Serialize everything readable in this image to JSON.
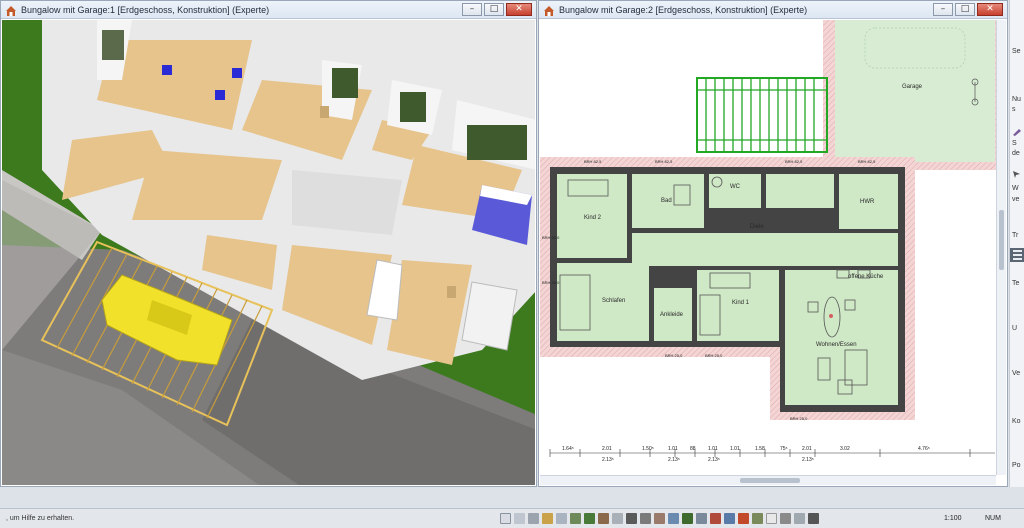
{
  "left_window": {
    "title": "Bungalow mit Garage:1 [Erdgeschoss, Konstruktion] (Experte)",
    "controls": {
      "minimize": "–",
      "maximize": "□",
      "close": "✕"
    }
  },
  "right_window": {
    "title": "Bungalow mit Garage:2 [Erdgeschoss, Konstruktion] (Experte)",
    "controls": {
      "minimize": "–",
      "maximize": "□",
      "close": "✕"
    },
    "rooms": {
      "garage": "Garage",
      "kind2": "Kind 2",
      "bad": "Bad",
      "wc": "WC",
      "hwr": "HWR",
      "diele": "Diele",
      "schlafen": "Schlafen",
      "ankleide": "Ankleide",
      "kind1": "Kind 1",
      "kueche": "offene Küche",
      "wohnen": "Wohnen/Essen"
    },
    "brh": [
      "BRH 82,5",
      "BRH 82,5",
      "BRH 82,5",
      "BRH 82,5",
      "BRH 25,0",
      "BRH 25,0",
      "BRH 25,0",
      "BRH 25,0",
      "BRH 25,0"
    ],
    "dimensions": [
      "1.64⁵",
      "2.01",
      "2.13⁵",
      "1.50⁵",
      "1.01",
      "2.13⁵",
      "88",
      "1.01",
      "2.13⁵",
      "1.01",
      "1.58",
      "75⁵",
      "2.01",
      "2.13⁵",
      "3.02",
      "4.76⁵"
    ]
  },
  "side_panel": {
    "items": [
      "Se",
      "Nu",
      "s",
      "S",
      "de",
      "W",
      "ve",
      "Tr",
      "Te",
      "U",
      "Ve",
      "Ko",
      "Po"
    ]
  },
  "statusbar": {
    "help_text": ", um Hilfe zu erhalten.",
    "scale": "1:100",
    "num": "NUM"
  },
  "colors": {
    "grass": "#3d7a1e",
    "floor": "#e6c48c",
    "wall3d": "#ececec",
    "room_fill": "#cfe8c6",
    "wall_hatch": "#e8b8b8",
    "car": "#f2e12a"
  }
}
